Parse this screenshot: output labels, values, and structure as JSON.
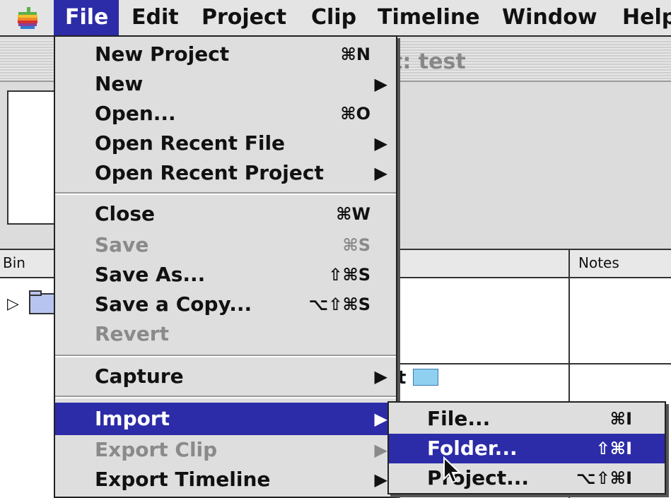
{
  "menubar": {
    "apple_icon": "apple-logo-icon",
    "items": [
      "File",
      "Edit",
      "Project",
      "Clip",
      "Timeline",
      "Window",
      "Help"
    ]
  },
  "background": {
    "window_title": "t: test",
    "columns": [
      "Bin",
      "Notes"
    ]
  },
  "file_menu": {
    "items": [
      {
        "label": "New Project",
        "shortcut": "⌘N"
      },
      {
        "label": "New",
        "submenu": true
      },
      {
        "label": "Open...",
        "shortcut": "⌘O"
      },
      {
        "label": "Open Recent File",
        "submenu": true
      },
      {
        "label": "Open Recent Project",
        "submenu": true
      },
      {
        "label": "Close",
        "shortcut": "⌘W"
      },
      {
        "label": "Save",
        "shortcut": "⌘S",
        "disabled": true
      },
      {
        "label": "Save As...",
        "shortcut": "⇧⌘S"
      },
      {
        "label": "Save a Copy...",
        "shortcut": "⌥⇧⌘S"
      },
      {
        "label": "Revert",
        "disabled": true
      },
      {
        "label": "Capture",
        "submenu": true
      },
      {
        "label": "Import",
        "submenu": true,
        "highlighted": true
      },
      {
        "label": "Export Clip",
        "submenu": true,
        "disabled": true
      },
      {
        "label": "Export Timeline",
        "submenu": true
      }
    ]
  },
  "import_submenu": {
    "items": [
      {
        "label": "File...",
        "shortcut": "⌘I"
      },
      {
        "label": "Folder...",
        "shortcut": "⇧⌘I",
        "highlighted": true
      },
      {
        "label": "Project...",
        "shortcut": "⌥⇧⌘I"
      }
    ]
  },
  "colors": {
    "highlight": "#2c2ca8",
    "menu_bg": "#dedede",
    "disabled_text": "#8a8a8a"
  },
  "arrow_glyph": "▶"
}
